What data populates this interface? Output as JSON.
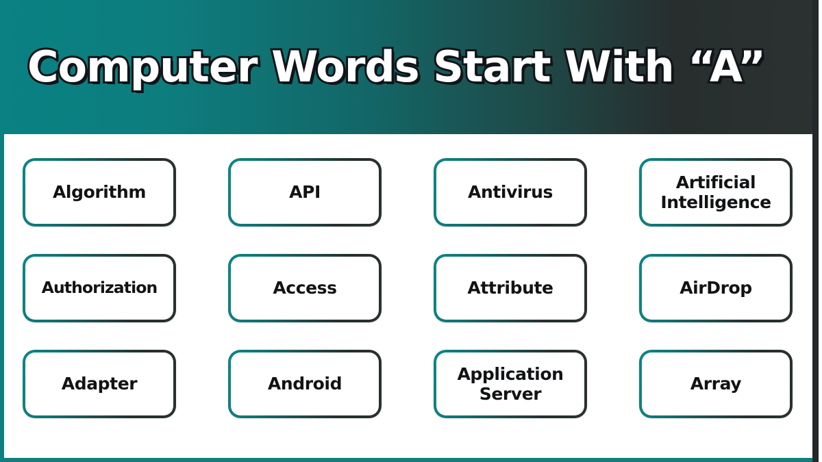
{
  "header": {
    "title": "Computer Words Start With “A”",
    "gradient_start_color": "#0a8183",
    "gradient_end_color": "#2b3231",
    "title_color": "#ffffff",
    "title_outline_color": "#111418"
  },
  "frame": {
    "left_border_color": "#0e7f80",
    "bottom_border_color": "#0e7f80",
    "right_border_color": "#23282a",
    "background_color": "#ffffff"
  },
  "card_style": {
    "border_gradient_start": "#0e8687",
    "border_gradient_end": "#2a302f",
    "fill_color": "#ffffff",
    "text_color": "#111315"
  },
  "grid": {
    "columns": 4,
    "rows": 3,
    "cards": [
      {
        "id": "algorithm",
        "label": "Algorithm",
        "row": 1,
        "col": 1,
        "lines": 1
      },
      {
        "id": "api",
        "label": "API",
        "row": 1,
        "col": 2,
        "lines": 1
      },
      {
        "id": "antivirus",
        "label": "Antivirus",
        "row": 1,
        "col": 3,
        "lines": 1
      },
      {
        "id": "artificial-intelligence",
        "label": "Artificial Intelligence",
        "row": 1,
        "col": 4,
        "lines": 2
      },
      {
        "id": "authorization",
        "label": "Authorization",
        "row": 2,
        "col": 1,
        "lines": 1
      },
      {
        "id": "access",
        "label": "Access",
        "row": 2,
        "col": 2,
        "lines": 1
      },
      {
        "id": "attribute",
        "label": "Attribute",
        "row": 2,
        "col": 3,
        "lines": 1
      },
      {
        "id": "airdrop",
        "label": "AirDrop",
        "row": 2,
        "col": 4,
        "lines": 1
      },
      {
        "id": "adapter",
        "label": "Adapter",
        "row": 3,
        "col": 1,
        "lines": 1
      },
      {
        "id": "android",
        "label": "Android",
        "row": 3,
        "col": 2,
        "lines": 1
      },
      {
        "id": "application-server",
        "label": "Application Server",
        "row": 3,
        "col": 3,
        "lines": 2
      },
      {
        "id": "array",
        "label": "Array",
        "row": 3,
        "col": 4,
        "lines": 1
      }
    ]
  }
}
